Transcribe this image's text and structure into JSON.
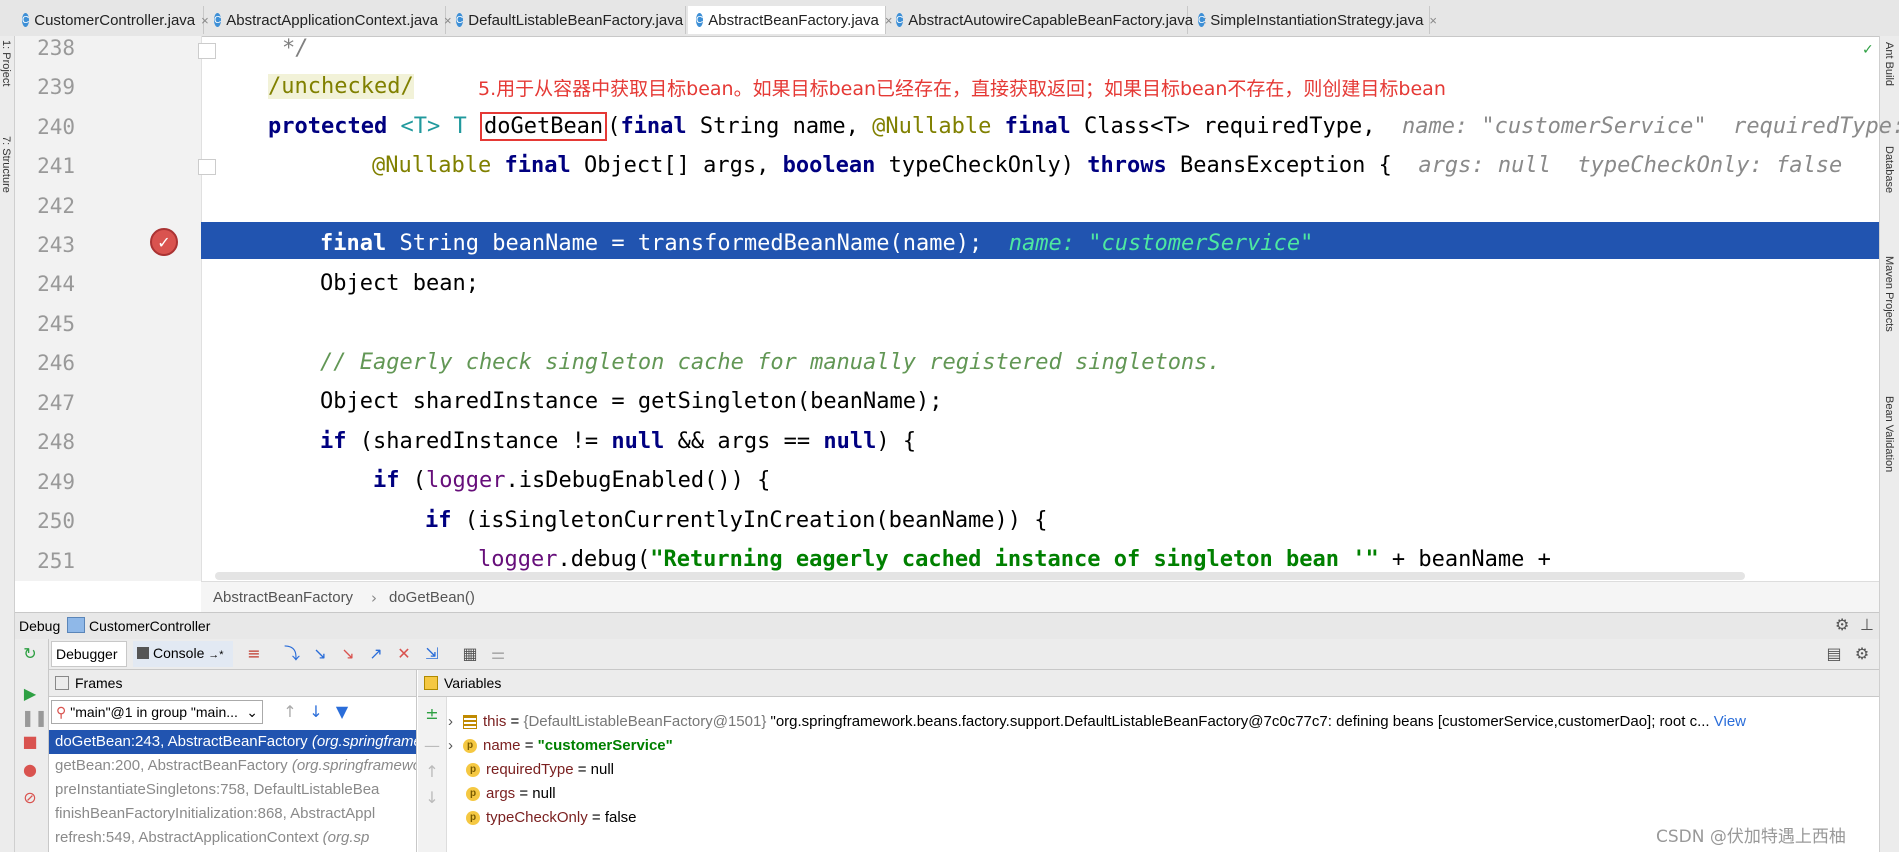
{
  "tabs": [
    {
      "label": "CustomerController.java",
      "active": false
    },
    {
      "label": "AbstractApplicationContext.java",
      "active": false
    },
    {
      "label": "DefaultListableBeanFactory.java",
      "active": false
    },
    {
      "label": "AbstractBeanFactory.java",
      "active": true
    },
    {
      "label": "AbstractAutowireCapableBeanFactory.java",
      "active": false
    },
    {
      "label": "SimpleInstantiationStrategy.java",
      "active": false
    }
  ],
  "left_strip": {
    "project": "1: Project",
    "structure": "7: Structure"
  },
  "right_strip": {
    "ant": "Ant Build",
    "database": "Database",
    "maven": "Maven Projects",
    "bean": "Bean Validation"
  },
  "annotation_text": "5.用于从容器中获取目标bean。如果目标bean已经存在，直接获取返回；如果目标bean不存在，则创建目标bean",
  "code": {
    "lines": [
      "238",
      "239",
      "240",
      "241",
      "242",
      "243",
      "244",
      "245",
      "246",
      "247",
      "248",
      "249",
      "250",
      "251"
    ],
    "l238": "*/",
    "l239": "/unchecked/",
    "l240_kw": "protected",
    "l240_t1": "<T>",
    "l240_t2": "T",
    "l240_method": "doGetBean",
    "l240_rest_a": "(",
    "l240_final1": "final",
    "l240_rest_b": " String name, ",
    "l240_nullable": "@Nullable",
    "l240_final2": "final",
    "l240_rest_c": " Class<T> requiredType,",
    "l240_hint": "name: \"customerService\"  requiredType:",
    "l241_nullable": "@Nullable",
    "l241_final": "final",
    "l241_rest_a": " Object[] args, ",
    "l241_boolean": "boolean",
    "l241_rest_b": " typeCheckOnly) ",
    "l241_throws": "throws",
    "l241_rest_c": " BeansException {",
    "l241_hint": "args: null  typeCheckOnly: false",
    "l243_final": "final",
    "l243_rest": " String beanName = transformedBeanName(name);",
    "l243_hint": "name: \"customerService\"",
    "l244": "Object bean;",
    "l246": "// Eagerly check singleton cache for manually registered singletons.",
    "l247": "Object sharedInstance = getSingleton(beanName);",
    "l248_if": "if",
    "l248_a": " (sharedInstance != ",
    "l248_null1": "null",
    "l248_b": " && args == ",
    "l248_null2": "null",
    "l248_c": ") {",
    "l249_if": "if",
    "l249_a": " (",
    "l249_logger": "logger",
    "l249_b": ".isDebugEnabled()) {",
    "l250_if": "if",
    "l250_rest": " (isSingletonCurrentlyInCreation(beanName)) {",
    "l251_logger": "logger",
    "l251_a": ".debug(",
    "l251_str": "\"Returning eagerly cached instance of singleton bean '\"",
    "l251_b": " + beanName +"
  },
  "breadcrumb": {
    "class": "AbstractBeanFactory",
    "sep": "›",
    "method": "doGetBean()"
  },
  "debug": {
    "title": "Debug",
    "config": "CustomerController",
    "tab_debugger": "Debugger",
    "tab_console": "Console",
    "frames_title": "Frames",
    "variables_title": "Variables",
    "thread": "\"main\"@1 in group \"main...",
    "frames": [
      {
        "method": "doGetBean:243, AbstractBeanFactory",
        "pkg": "(org.springframework",
        "selected": true
      },
      {
        "method": "getBean:200, AbstractBeanFactory",
        "pkg": "(org.springframework",
        "selected": false
      },
      {
        "method": "preInstantiateSingletons:758, DefaultListableBea",
        "pkg": "",
        "selected": false
      },
      {
        "method": "finishBeanFactoryInitialization:868, AbstractAppl",
        "pkg": "",
        "selected": false
      },
      {
        "method": "refresh:549, AbstractApplicationContext",
        "pkg": "(org.sp",
        "selected": false
      }
    ],
    "vars": {
      "this_name": "this",
      "this_eq": " = ",
      "this_val": "{DefaultListableBeanFactory@1501}",
      "this_str": " \"org.springframework.beans.factory.support.DefaultListableBeanFactory@7c0c77c7: defining beans [customerService,customerDao]; root c...",
      "this_view": "View",
      "name_name": "name",
      "name_val": "\"customerService\"",
      "rt_name": "requiredType",
      "rt_val": " = null",
      "args_name": "args",
      "args_val": " = null",
      "tco_name": "typeCheckOnly",
      "tco_val": " = false"
    }
  },
  "watermark": "CSDN @伏加特遇上西柚",
  "colors": {
    "highlight": "#2154b0",
    "annotation": "#e53935",
    "keyword": "#000080",
    "string": "#008000"
  }
}
